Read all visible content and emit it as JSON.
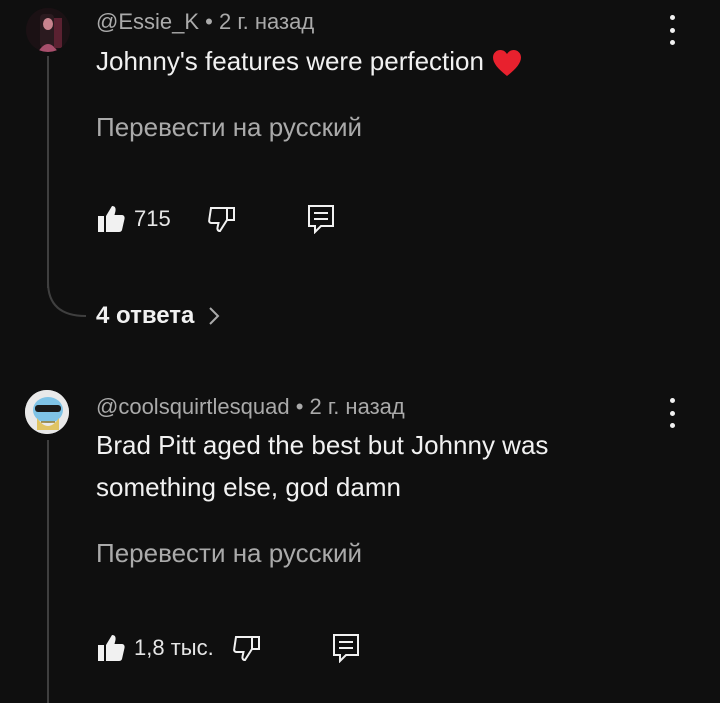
{
  "comments": [
    {
      "handle": "@Essie_K",
      "separator": "•",
      "age": "2 г. назад",
      "text": "Johnny's features were perfection",
      "emoji": "red-heart",
      "translate_label": "Перевести на русский",
      "likes": "715",
      "replies_label": "4 ответа"
    },
    {
      "handle": "@coolsquirtlesquad",
      "separator": "•",
      "age": "2 г. назад",
      "text_line1": "Brad Pitt aged the best but Johnny was",
      "text_line2": "something else, god damn",
      "translate_label": "Перевести на русский",
      "likes": "1,8 тыс."
    }
  ],
  "colors": {
    "background": "#0f0f0f",
    "text": "#f1f1f1",
    "secondary": "#aaaaaa",
    "heart": "#e8212e"
  },
  "icons": [
    "thumbs-up-icon",
    "thumbs-down-icon",
    "reply-icon",
    "more-vert-icon",
    "chevron-right-icon",
    "heart-icon"
  ]
}
